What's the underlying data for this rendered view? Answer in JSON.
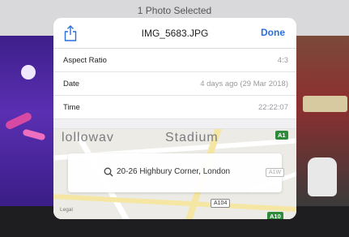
{
  "backdrop": {
    "title": "1 Photo Selected"
  },
  "sheet": {
    "title": "IMG_5683.JPG",
    "done_label": "Done",
    "rows": [
      {
        "label": "Aspect Ratio",
        "value": "4:3"
      },
      {
        "label": "Date",
        "value": "4 days ago (29 Mar 2018)"
      },
      {
        "label": "Time",
        "value": "22:22:07"
      }
    ]
  },
  "map": {
    "label_left": "lollowav",
    "label_right": "Stadium",
    "search_text": "20-26 Highbury Corner, London",
    "legal": "Legal",
    "roads": {
      "a104": "A104",
      "a10": "A10",
      "top_badge": "A1",
      "small_plate": "A1W"
    }
  },
  "colors": {
    "accent": "#2a6fdb",
    "road_badge": "#2e8b3a"
  }
}
